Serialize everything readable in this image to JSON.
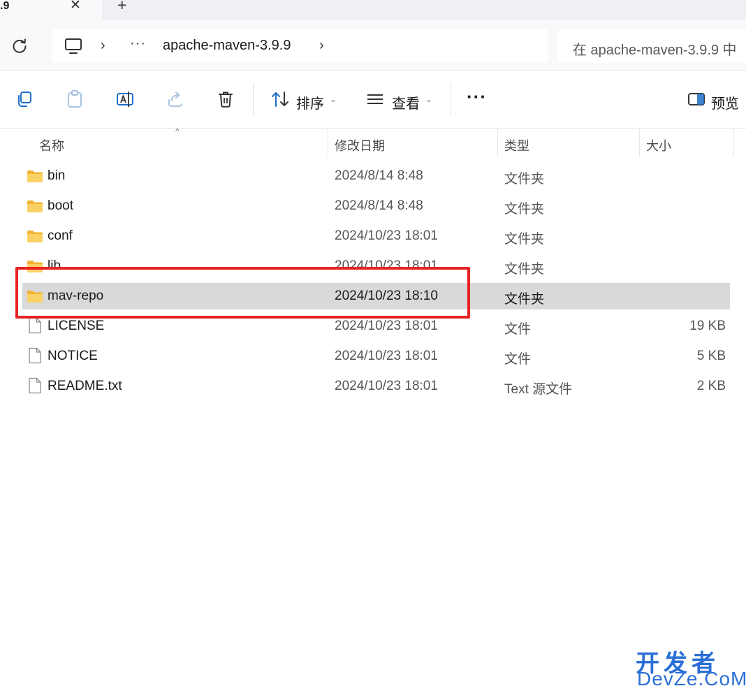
{
  "tab": {
    "title": ".9",
    "close_glyph": "✕",
    "new_glyph": "+"
  },
  "address": {
    "separator": "›",
    "more": "···",
    "current": "apache-maven-3.9.9"
  },
  "search": {
    "placeholder": "在 apache-maven-3.9.9 中"
  },
  "toolbar": {
    "sort_label": "排序",
    "view_label": "查看",
    "more": "···",
    "preview_label": "预览",
    "caret": "⌄"
  },
  "columns": {
    "name": "名称",
    "date": "修改日期",
    "type": "类型",
    "size": "大小",
    "sort_glyph": "^"
  },
  "files": [
    {
      "name": "bin",
      "date": "2024/8/14 8:48",
      "type": "文件夹",
      "size": "",
      "kind": "folder"
    },
    {
      "name": "boot",
      "date": "2024/8/14 8:48",
      "type": "文件夹",
      "size": "",
      "kind": "folder"
    },
    {
      "name": "conf",
      "date": "2024/10/23 18:01",
      "type": "文件夹",
      "size": "",
      "kind": "folder"
    },
    {
      "name": "lib",
      "date": "2024/10/23 18:01",
      "type": "文件夹",
      "size": "",
      "kind": "folder"
    },
    {
      "name": "mav-repo",
      "date": "2024/10/23 18:10",
      "type": "文件夹",
      "size": "",
      "kind": "folder",
      "selected": true
    },
    {
      "name": "LICENSE",
      "date": "2024/10/23 18:01",
      "type": "文件",
      "size": "19 KB",
      "kind": "file"
    },
    {
      "name": "NOTICE",
      "date": "2024/10/23 18:01",
      "type": "文件",
      "size": "5 KB",
      "kind": "file"
    },
    {
      "name": "README.txt",
      "date": "2024/10/23 18:01",
      "type": "Text 源文件",
      "size": "2 KB",
      "kind": "file"
    }
  ],
  "watermark": {
    "cn": "开发者",
    "en": "DevZe.CoM"
  },
  "colors": {
    "highlight": "#e82323",
    "selected_row": "#d9d9d9",
    "folder": "#f5c544",
    "watermark": "#2b6fd6"
  }
}
